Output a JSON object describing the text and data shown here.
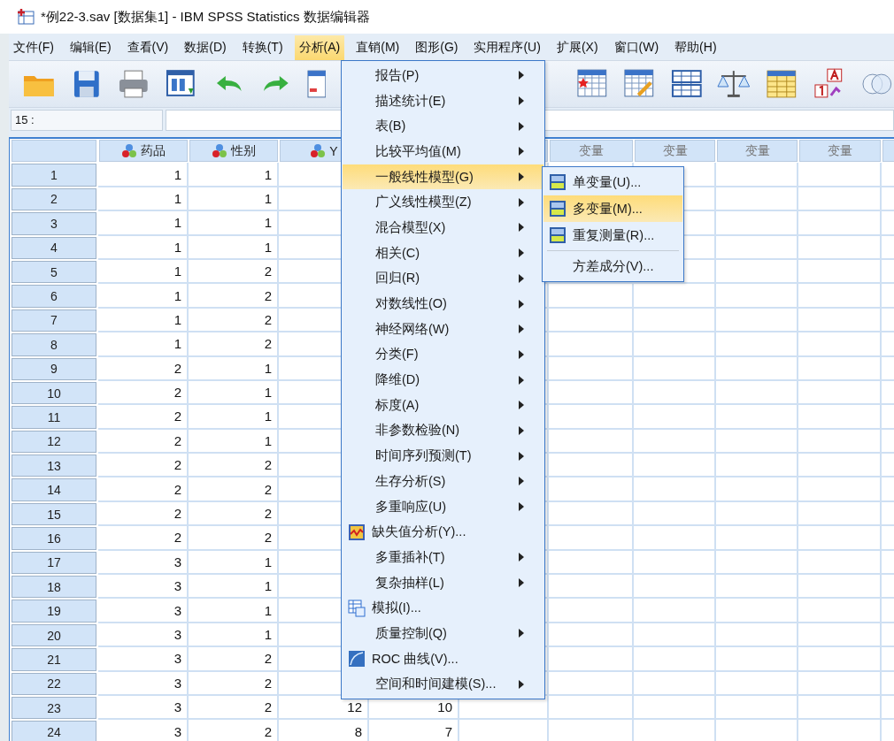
{
  "window": {
    "title": "*例22-3.sav [数据集1] - IBM SPSS Statistics 数据编辑器"
  },
  "menu_bar": [
    {
      "label": "文件(F)",
      "selected": false
    },
    {
      "label": "编辑(E)",
      "selected": false
    },
    {
      "label": "查看(V)",
      "selected": false
    },
    {
      "label": "数据(D)",
      "selected": false
    },
    {
      "label": "转换(T)",
      "selected": false
    },
    {
      "label": "分析(A)",
      "selected": true
    },
    {
      "label": "直销(M)",
      "selected": false
    },
    {
      "label": "图形(G)",
      "selected": false
    },
    {
      "label": "实用程序(U)",
      "selected": false
    },
    {
      "label": "扩展(X)",
      "selected": false
    },
    {
      "label": "窗口(W)",
      "selected": false
    },
    {
      "label": "帮助(H)",
      "selected": false
    }
  ],
  "cell_editor": {
    "cell_ref": "15 :"
  },
  "grid": {
    "columns": [
      {
        "kind": "variable",
        "label": "药品"
      },
      {
        "kind": "variable",
        "label": "性别"
      },
      {
        "kind": "variable",
        "label": "Y"
      },
      {
        "kind": "covered"
      },
      {
        "kind": "covered"
      },
      {
        "kind": "empty",
        "label": "变量"
      },
      {
        "kind": "empty",
        "label": "变量"
      },
      {
        "kind": "empty",
        "label": "变量"
      },
      {
        "kind": "empty",
        "label": "变量"
      }
    ],
    "rows": [
      {
        "number": "1",
        "cells": [
          "1",
          "1"
        ]
      },
      {
        "number": "2",
        "cells": [
          "1",
          "1"
        ]
      },
      {
        "number": "3",
        "cells": [
          "1",
          "1"
        ]
      },
      {
        "number": "4",
        "cells": [
          "1",
          "1"
        ]
      },
      {
        "number": "5",
        "cells": [
          "1",
          "2"
        ]
      },
      {
        "number": "6",
        "cells": [
          "1",
          "2"
        ]
      },
      {
        "number": "7",
        "cells": [
          "1",
          "2"
        ]
      },
      {
        "number": "8",
        "cells": [
          "1",
          "2"
        ]
      },
      {
        "number": "9",
        "cells": [
          "2",
          "1"
        ]
      },
      {
        "number": "10",
        "cells": [
          "2",
          "1"
        ]
      },
      {
        "number": "11",
        "cells": [
          "2",
          "1"
        ]
      },
      {
        "number": "12",
        "cells": [
          "2",
          "1"
        ]
      },
      {
        "number": "13",
        "cells": [
          "2",
          "2"
        ]
      },
      {
        "number": "14",
        "cells": [
          "2",
          "2"
        ]
      },
      {
        "number": "15",
        "cells": [
          "2",
          "2"
        ]
      },
      {
        "number": "16",
        "cells": [
          "2",
          "2"
        ]
      },
      {
        "number": "17",
        "cells": [
          "3",
          "1"
        ]
      },
      {
        "number": "18",
        "cells": [
          "3",
          "1"
        ]
      },
      {
        "number": "19",
        "cells": [
          "3",
          "1"
        ]
      },
      {
        "number": "20",
        "cells": [
          "3",
          "1"
        ]
      },
      {
        "number": "21",
        "cells": [
          "3",
          "2"
        ]
      },
      {
        "number": "22",
        "cells": [
          "3",
          "2"
        ]
      },
      {
        "number": "23",
        "cells": [
          "3",
          "2",
          "12",
          "10"
        ]
      },
      {
        "number": "24",
        "cells": [
          "3",
          "2",
          "8",
          "7"
        ]
      }
    ]
  },
  "analyze_menu": {
    "items": [
      {
        "label": "报告(P)",
        "kind": "submenu",
        "selected": false
      },
      {
        "label": "描述统计(E)",
        "kind": "submenu",
        "selected": false
      },
      {
        "label": "表(B)",
        "kind": "submenu",
        "selected": false
      },
      {
        "label": "比较平均值(M)",
        "kind": "submenu",
        "selected": false
      },
      {
        "label": "一般线性模型(G)",
        "kind": "submenu",
        "selected": true
      },
      {
        "label": "广义线性模型(Z)",
        "kind": "submenu",
        "selected": false
      },
      {
        "label": "混合模型(X)",
        "kind": "submenu",
        "selected": false
      },
      {
        "label": "相关(C)",
        "kind": "submenu",
        "selected": false
      },
      {
        "label": "回归(R)",
        "kind": "submenu",
        "selected": false
      },
      {
        "label": "对数线性(O)",
        "kind": "submenu",
        "selected": false
      },
      {
        "label": "神经网络(W)",
        "kind": "submenu",
        "selected": false
      },
      {
        "label": "分类(F)",
        "kind": "submenu",
        "selected": false
      },
      {
        "label": "降维(D)",
        "kind": "submenu",
        "selected": false
      },
      {
        "label": "标度(A)",
        "kind": "submenu",
        "selected": false
      },
      {
        "label": "非参数检验(N)",
        "kind": "submenu",
        "selected": false
      },
      {
        "label": "时间序列预测(T)",
        "kind": "submenu",
        "selected": false
      },
      {
        "label": "生存分析(S)",
        "kind": "submenu",
        "selected": false
      },
      {
        "label": "多重响应(U)",
        "kind": "submenu",
        "selected": false
      },
      {
        "label": "缺失值分析(Y)...",
        "kind": "chart",
        "selected": false
      },
      {
        "label": "多重插补(T)",
        "kind": "submenu",
        "selected": false
      },
      {
        "label": "复杂抽样(L)",
        "kind": "submenu",
        "selected": false
      },
      {
        "label": "模拟(I)...",
        "kind": "table",
        "selected": false
      },
      {
        "label": "质量控制(Q)",
        "kind": "submenu",
        "selected": false
      },
      {
        "label": "ROC 曲线(V)...",
        "kind": "curve",
        "selected": false
      },
      {
        "label": "空间和时间建模(S)...",
        "kind": "submenu",
        "selected": false
      }
    ]
  },
  "submenu": {
    "items": [
      {
        "label": "单变量(U)...",
        "selected": false,
        "kind": "model"
      },
      {
        "label": "多变量(M)...",
        "selected": true,
        "kind": "model"
      },
      {
        "label": "重复测量(R)...",
        "selected": false,
        "kind": "model"
      },
      {
        "label": "方差成分(V)...",
        "selected": false,
        "kind": "separated"
      }
    ]
  }
}
